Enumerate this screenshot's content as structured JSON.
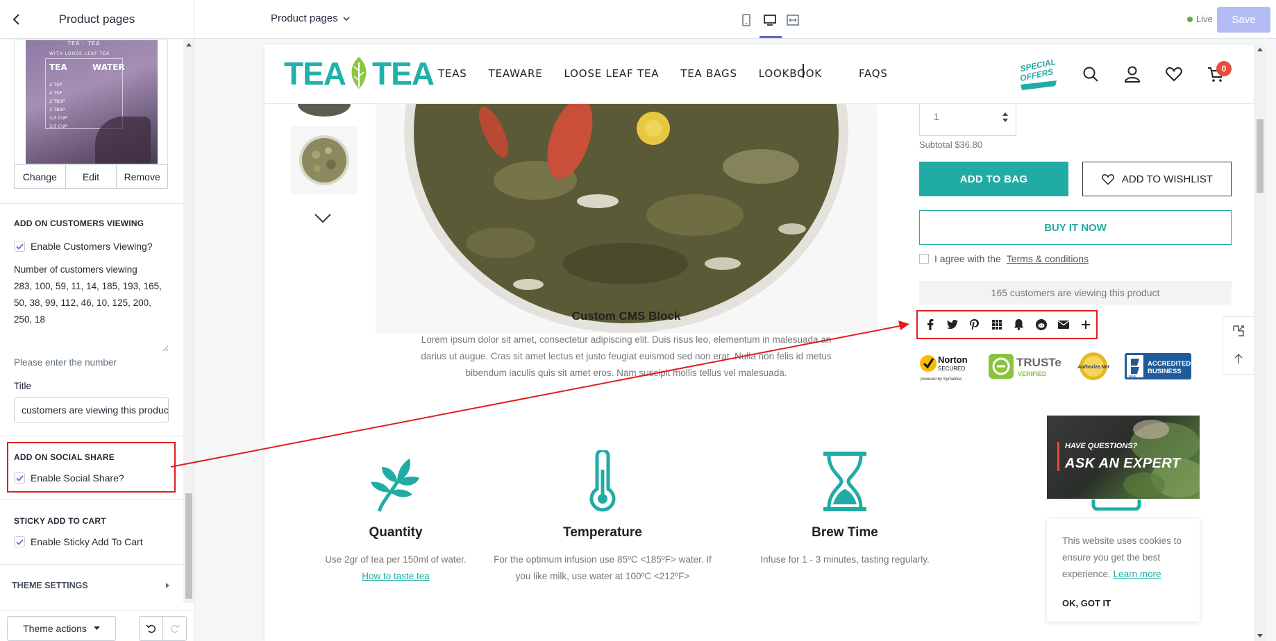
{
  "topbar": {
    "title": "Product pages",
    "page_select": "Product pages",
    "live_label": "Live",
    "save_label": "Save"
  },
  "sidebar": {
    "image_preview": {
      "brand": "TEA · TEA",
      "caption_small": "WITH LOOSE LEAF TEA",
      "col_tea": "TEA",
      "col_water": "WATER",
      "rows": [
        "2 TSP",
        "4 TSP",
        "2 TBSP",
        "3 TBSP",
        "1/3 CUP",
        "2/3 CUP"
      ]
    },
    "image_actions": {
      "change": "Change",
      "edit": "Edit",
      "remove": "Remove"
    },
    "customers_viewing": {
      "heading": "ADD ON CUSTOMERS VIEWING",
      "enable_label": "Enable Customers Viewing?",
      "number_label": "Number of customers viewing",
      "number_value": "283, 100, 59, 11, 14, 185, 193, 165, 50, 38, 99, 112, 46, 10, 125, 200, 250, 18",
      "help": "Please enter the number",
      "title_label": "Title",
      "title_value": "customers are viewing this product"
    },
    "social_share": {
      "heading": "ADD ON SOCIAL SHARE",
      "enable_label": "Enable Social Share?"
    },
    "sticky_cart": {
      "heading": "STICKY ADD TO CART",
      "enable_label": "Enable Sticky Add To Cart"
    },
    "theme_settings": "THEME SETTINGS",
    "theme_actions": "Theme actions"
  },
  "store": {
    "logo_left": "TEA",
    "logo_right": "TEA",
    "nav": [
      "TEAS",
      "TEAWARE",
      "LOOSE LEAF TEA",
      "TEA BAGS",
      "LOOKBOOK",
      "FAQS"
    ],
    "special_offers": "SPECIAL OFFERS",
    "cart_count": "0",
    "qty_value": "1",
    "subtotal": "Subtotal $36.80",
    "add_to_bag": "ADD TO BAG",
    "add_to_wishlist": "ADD TO WISHLIST",
    "buy_now": "BUY IT NOW",
    "agree_text": "I agree with the",
    "agree_link": "Terms & conditions",
    "viewing_text": "165 customers are viewing this product",
    "share_icons": [
      "facebook-icon",
      "twitter-icon",
      "pinterest-icon",
      "grid-icon",
      "bell-icon",
      "reddit-icon",
      "mail-icon",
      "plus-icon"
    ],
    "trust": {
      "norton_1": "Norton",
      "norton_2": "SECURED",
      "norton_3": "powered by Symantec",
      "truste_1": "TRUSTe",
      "truste_2": "VERIFIED",
      "authnet": "Authorize.Net",
      "bbb_1": "ACCREDITED",
      "bbb_2": "BUSINESS",
      "bbb_3": "BBB"
    },
    "cms": {
      "title": "Custom CMS Block",
      "body": "Lorem ipsum dolor sit amet, consectetur adipiscing elit. Duis risus leo, elementum in malesuada an darius ut augue. Cras sit amet lectus et justo feugiat euismod sed non erat. Nulla non felis id metus bibendum iaculis quis sit amet eros. Nam suscipit mollis tellus vel malesuada."
    },
    "features": [
      {
        "title": "Quantity",
        "desc": "Use 2gr of tea per 150ml of water.",
        "link": "How to taste tea"
      },
      {
        "title": "Temperature",
        "desc": "For the optimum infusion use 85ºC <185ºF> water. If you like milk, use water at 100ºC <212ºF>"
      },
      {
        "title": "Brew Time",
        "desc": "Infuse for 1 - 3 minutes, tasting regularly."
      }
    ],
    "ask_expert": {
      "question": "HAVE QUESTIONS?",
      "main": "ASK AN EXPERT"
    },
    "cookie": {
      "text": "This website uses cookies to ensure you get the best experience.",
      "link": "Learn more",
      "ok": "OK, GOT IT"
    }
  },
  "colors": {
    "accent": "#20aca4",
    "highlight": "#e01e1e",
    "save_disabled": "#b3bcf5"
  }
}
